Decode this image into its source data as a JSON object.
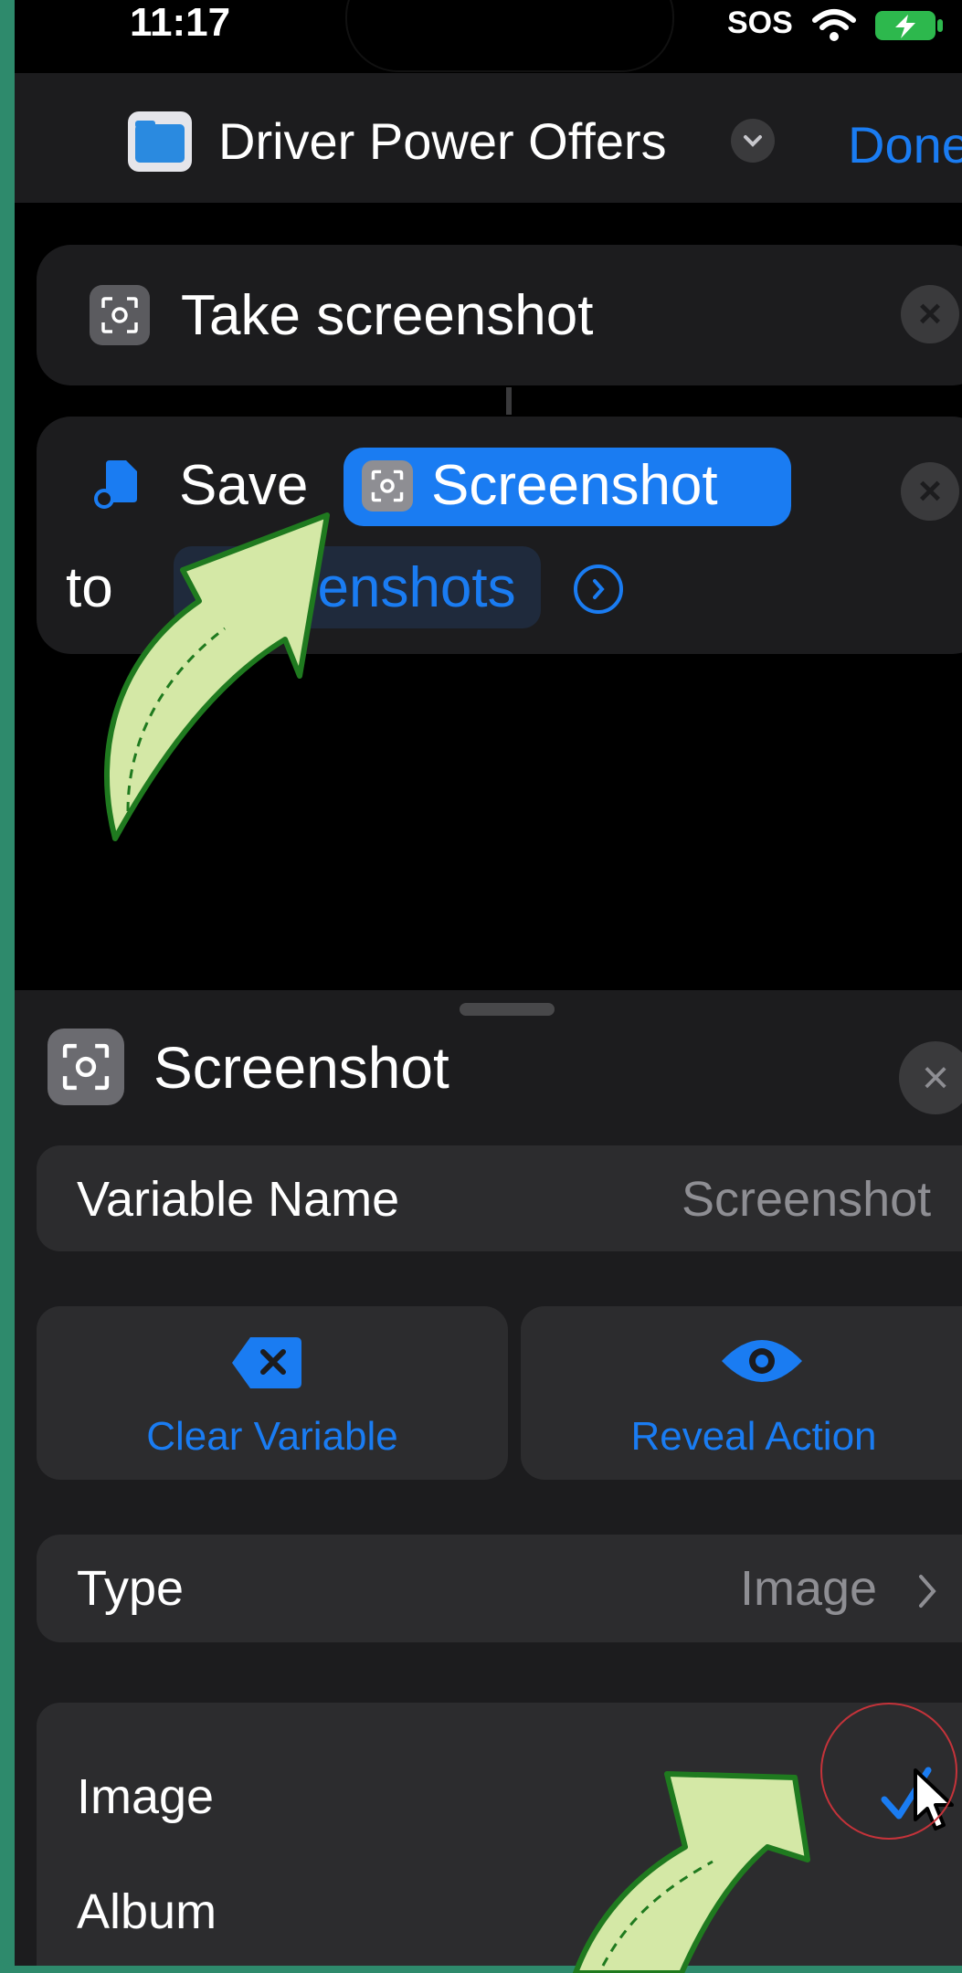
{
  "status_bar": {
    "time": "11:17",
    "carrier": "SOS",
    "wifi_icon": "wifi-icon",
    "battery_icon": "battery-charging-icon"
  },
  "nav": {
    "title": "Driver Power Offers",
    "done_label": "Done",
    "folder_icon": "folder-icon",
    "menu_icon": "chevron-down-icon"
  },
  "actions": [
    {
      "title": "Take screenshot",
      "icon": "screenshot-icon"
    },
    {
      "verb": "Save",
      "variable": "Screenshot",
      "preposition": "to",
      "destination": "Screenshots",
      "icon": "save-to-photos-icon"
    }
  ],
  "sheet": {
    "title": "Screenshot",
    "variable_name_label": "Variable Name",
    "variable_name_value": "Screenshot",
    "clear_label": "Clear Variable",
    "reveal_label": "Reveal Action",
    "type_label": "Type",
    "type_value": "Image",
    "options": [
      "Image",
      "Album"
    ],
    "selected_option": "Image"
  },
  "colors": {
    "accent": "#1a7cf2",
    "background": "#000000",
    "panel": "#1c1c1e",
    "row": "#2c2c2e",
    "frame": "#2e8a6c",
    "arrow_fill": "#d4e8a6",
    "arrow_stroke": "#1f7a1f",
    "highlight_circle": "#c5333a"
  }
}
